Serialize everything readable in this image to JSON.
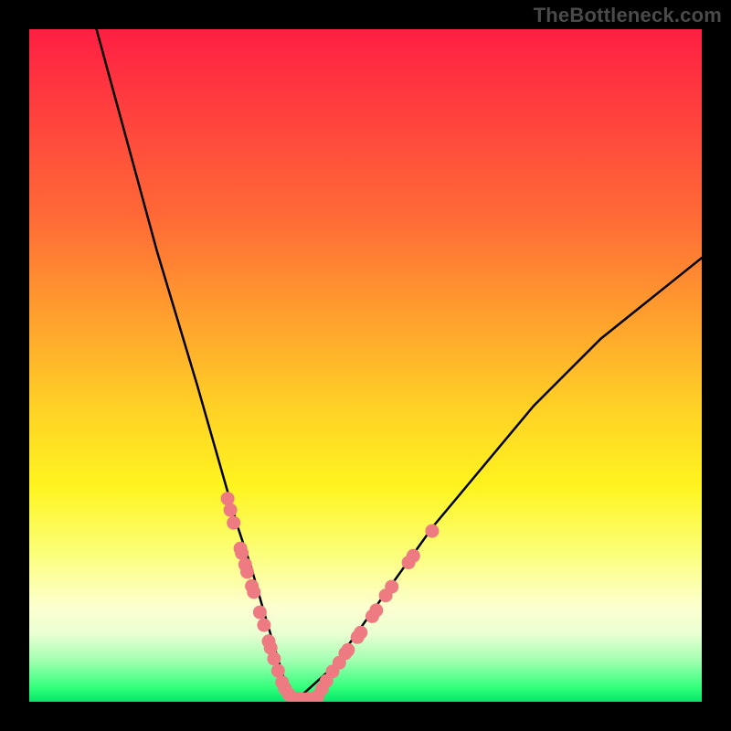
{
  "watermark": "TheBottleneck.com",
  "chart_data": {
    "type": "line",
    "title": "",
    "xlabel": "",
    "ylabel": "",
    "xlim": [
      0,
      100
    ],
    "ylim": [
      0,
      100
    ],
    "grid": false,
    "note": "No axis ticks or numeric labels visible; values below are pixel-proportional estimates read off the 736×736 plot area mapped to a 0–100 range.",
    "series": [
      {
        "name": "curve",
        "type": "line",
        "color": "#000000",
        "x": [
          10,
          13,
          16,
          19,
          22,
          25,
          27,
          29,
          31,
          33,
          35,
          36.5,
          38,
          40,
          45,
          50,
          55,
          60,
          65,
          70,
          75,
          80,
          85,
          90,
          95,
          100
        ],
        "y": [
          100,
          89,
          78,
          67,
          57,
          47,
          40,
          33,
          26,
          20,
          13,
          8,
          3,
          0.5,
          5,
          12,
          19,
          26,
          32,
          38,
          44,
          49,
          54,
          58,
          62,
          66
        ]
      },
      {
        "name": "markers-left",
        "type": "scatter",
        "color": "#ef7b82",
        "x": [
          29.5,
          29.9,
          30.4,
          31.4,
          31.6,
          32.1,
          32.4,
          33.1,
          33.4,
          34.3,
          34.9,
          35.6,
          35.9,
          36.4,
          37.0,
          37.6,
          38.0,
          38.6,
          39.5,
          40.5,
          41.3,
          42.1
        ],
        "y": [
          30.2,
          28.5,
          26.6,
          22.8,
          22.1,
          20.4,
          19.3,
          17.2,
          16.3,
          13.3,
          11.4,
          9.0,
          8.0,
          6.4,
          4.6,
          2.9,
          2.0,
          1.1,
          0.5,
          0.4,
          0.4,
          0.4
        ]
      },
      {
        "name": "markers-right",
        "type": "scatter",
        "color": "#ef7b82",
        "x": [
          42.9,
          43.5,
          44.2,
          45.1,
          46.1,
          47.0,
          47.4,
          48.8,
          49.3,
          51.0,
          51.6,
          53.0,
          53.9,
          56.4,
          57.1,
          59.9
        ],
        "y": [
          0.8,
          1.9,
          3.1,
          4.5,
          5.8,
          7.2,
          7.7,
          9.6,
          10.3,
          12.7,
          13.6,
          15.8,
          17.1,
          20.7,
          21.7,
          25.4
        ]
      }
    ]
  }
}
